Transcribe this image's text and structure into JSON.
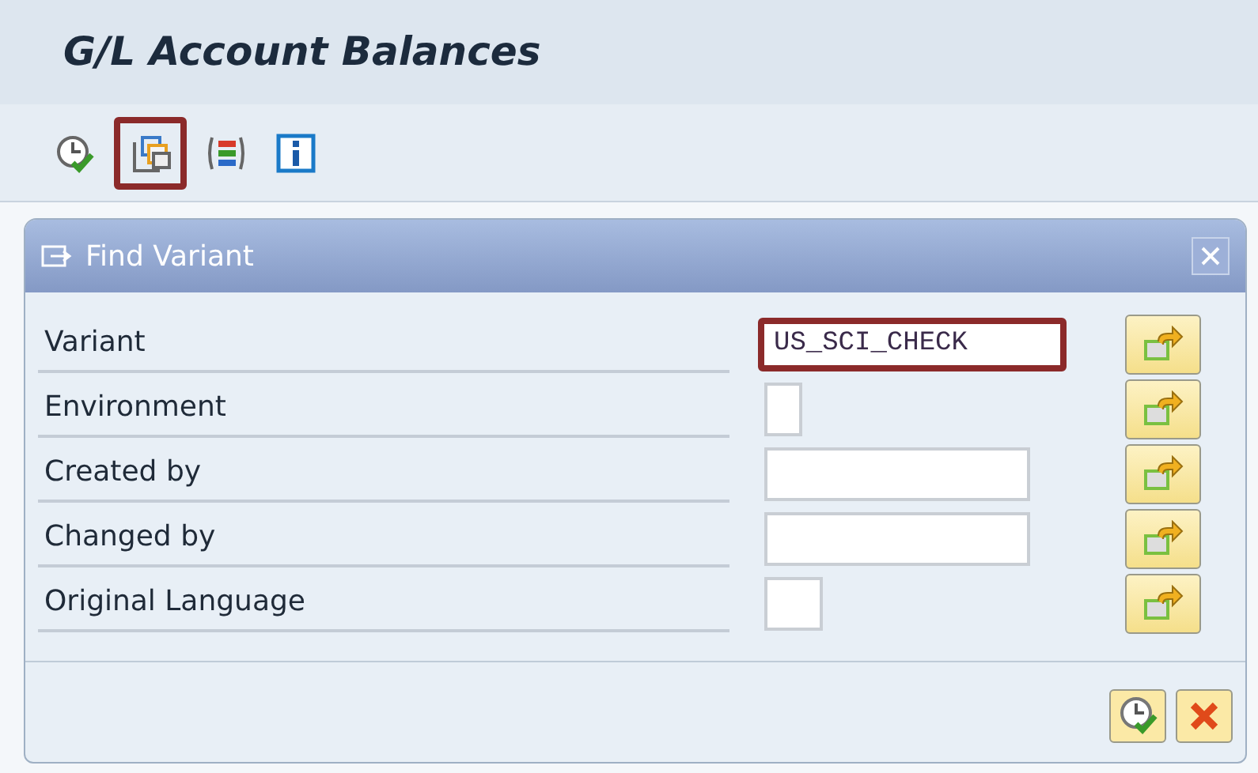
{
  "window": {
    "title": "G/L Account Balances"
  },
  "toolbar": [
    {
      "kind": "execute",
      "highlighted": false
    },
    {
      "kind": "variant",
      "highlighted": true
    },
    {
      "kind": "selections",
      "highlighted": false
    },
    {
      "kind": "info",
      "highlighted": false
    }
  ],
  "dialog": {
    "title": "Find Variant",
    "rows": [
      {
        "label": "Variant",
        "kind": "name",
        "value": "US_SCI_CHECK",
        "highlighted": true
      },
      {
        "label": "Environment",
        "kind": "flag",
        "highlighted": false
      },
      {
        "label": "Created by",
        "kind": "user",
        "highlighted": false
      },
      {
        "label": "Changed by",
        "kind": "user",
        "highlighted": false
      },
      {
        "label": "Original Language",
        "kind": "lang",
        "highlighted": false
      }
    ]
  }
}
